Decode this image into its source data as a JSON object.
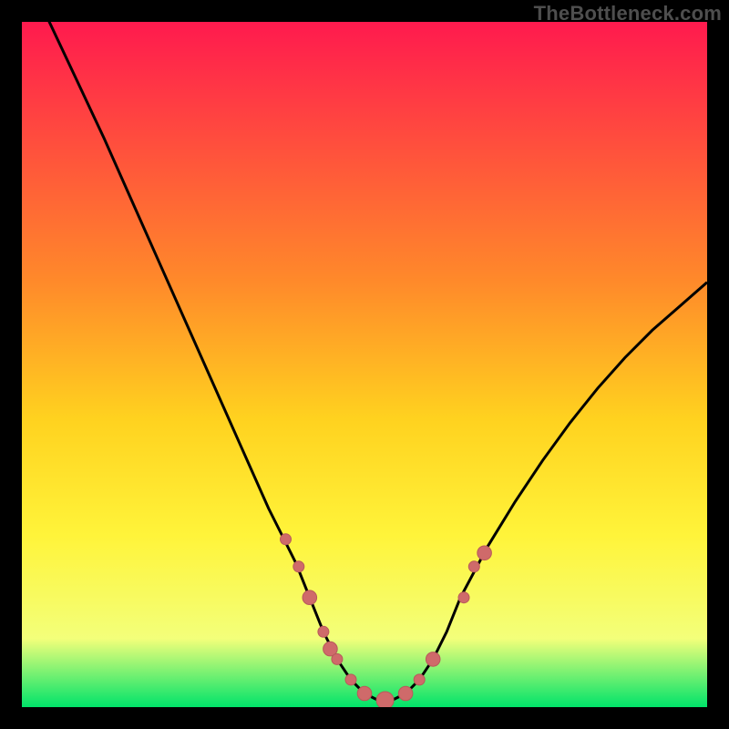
{
  "watermark": "TheBottleneck.com",
  "colors": {
    "frame": "#000000",
    "grad_top": "#ff1a4e",
    "grad_mid1": "#ff8a2a",
    "grad_mid2": "#ffd21f",
    "grad_mid3": "#fff43a",
    "grad_mid4": "#f3ff7a",
    "grad_bottom": "#00e36a",
    "curve": "#000000",
    "marker_fill": "#cf6a6a",
    "marker_stroke": "#b85a5a"
  },
  "chart_data": {
    "type": "line",
    "title": "",
    "xlabel": "",
    "ylabel": "",
    "xlim": [
      0,
      100
    ],
    "ylim": [
      0,
      100
    ],
    "curve": {
      "x": [
        0,
        4,
        8,
        12,
        16,
        20,
        24,
        28,
        32,
        36,
        38,
        40,
        42,
        44,
        46,
        48,
        50,
        52,
        54,
        56,
        58,
        60,
        62,
        64,
        68,
        72,
        76,
        80,
        84,
        88,
        92,
        96,
        100
      ],
      "y": [
        108,
        100,
        91.5,
        83,
        74,
        65,
        56,
        47,
        38,
        29,
        25,
        21,
        16,
        11,
        7,
        4,
        2,
        1,
        1,
        2,
        4,
        7,
        11,
        16,
        23.5,
        30,
        36,
        41.5,
        46.5,
        51,
        55,
        58.5,
        62
      ]
    },
    "series": [
      {
        "name": "markers",
        "points": [
          {
            "x": 38.5,
            "y": 24.5,
            "r": 6
          },
          {
            "x": 40.4,
            "y": 20.5,
            "r": 6
          },
          {
            "x": 42.0,
            "y": 16.0,
            "r": 7.8
          },
          {
            "x": 44.0,
            "y": 11.0,
            "r": 6
          },
          {
            "x": 45.0,
            "y": 8.5,
            "r": 7.8
          },
          {
            "x": 46.0,
            "y": 7.0,
            "r": 6
          },
          {
            "x": 48.0,
            "y": 4.0,
            "r": 6
          },
          {
            "x": 50.0,
            "y": 2.0,
            "r": 7.8
          },
          {
            "x": 53.0,
            "y": 1.0,
            "r": 9.5
          },
          {
            "x": 56.0,
            "y": 2.0,
            "r": 7.8
          },
          {
            "x": 58.0,
            "y": 4.0,
            "r": 6
          },
          {
            "x": 60.0,
            "y": 7.0,
            "r": 7.8
          },
          {
            "x": 64.5,
            "y": 16.0,
            "r": 6
          },
          {
            "x": 66.0,
            "y": 20.5,
            "r": 6
          },
          {
            "x": 67.5,
            "y": 22.5,
            "r": 7.8
          }
        ]
      }
    ]
  }
}
